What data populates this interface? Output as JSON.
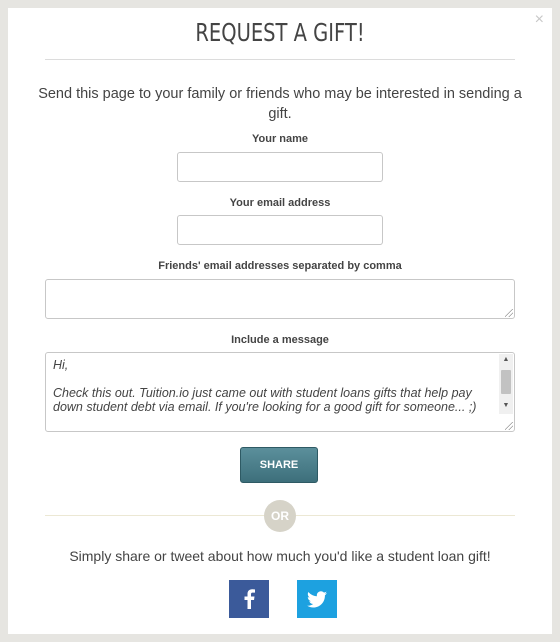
{
  "modal": {
    "title": "REQUEST A GIFT!",
    "close_glyph": "×",
    "intro": "Send this page to your family or friends who may be interested in sending a gift."
  },
  "form": {
    "name_label": "Your name",
    "name_value": "",
    "email_label": "Your email address",
    "email_value": "",
    "friends_label": "Friends' email addresses separated by comma",
    "friends_value": "",
    "message_label": "Include a message",
    "message_value": "Hi,\n\nCheck this out. Tuition.io just came out with student loans gifts that help pay down student debt via email. If you're looking for a good gift for someone... ;)",
    "share_label": "SHARE"
  },
  "divider": {
    "or_label": "OR"
  },
  "social": {
    "outro": "Simply share or tweet about how much you'd like a student loan gift!",
    "facebook_icon": "facebook-icon",
    "twitter_icon": "twitter-icon",
    "facebook_color": "#3b5a9a",
    "twitter_color": "#1da1e0"
  },
  "colors": {
    "share_button": "#4a7f8b",
    "or_circle": "#d6d3c8"
  }
}
